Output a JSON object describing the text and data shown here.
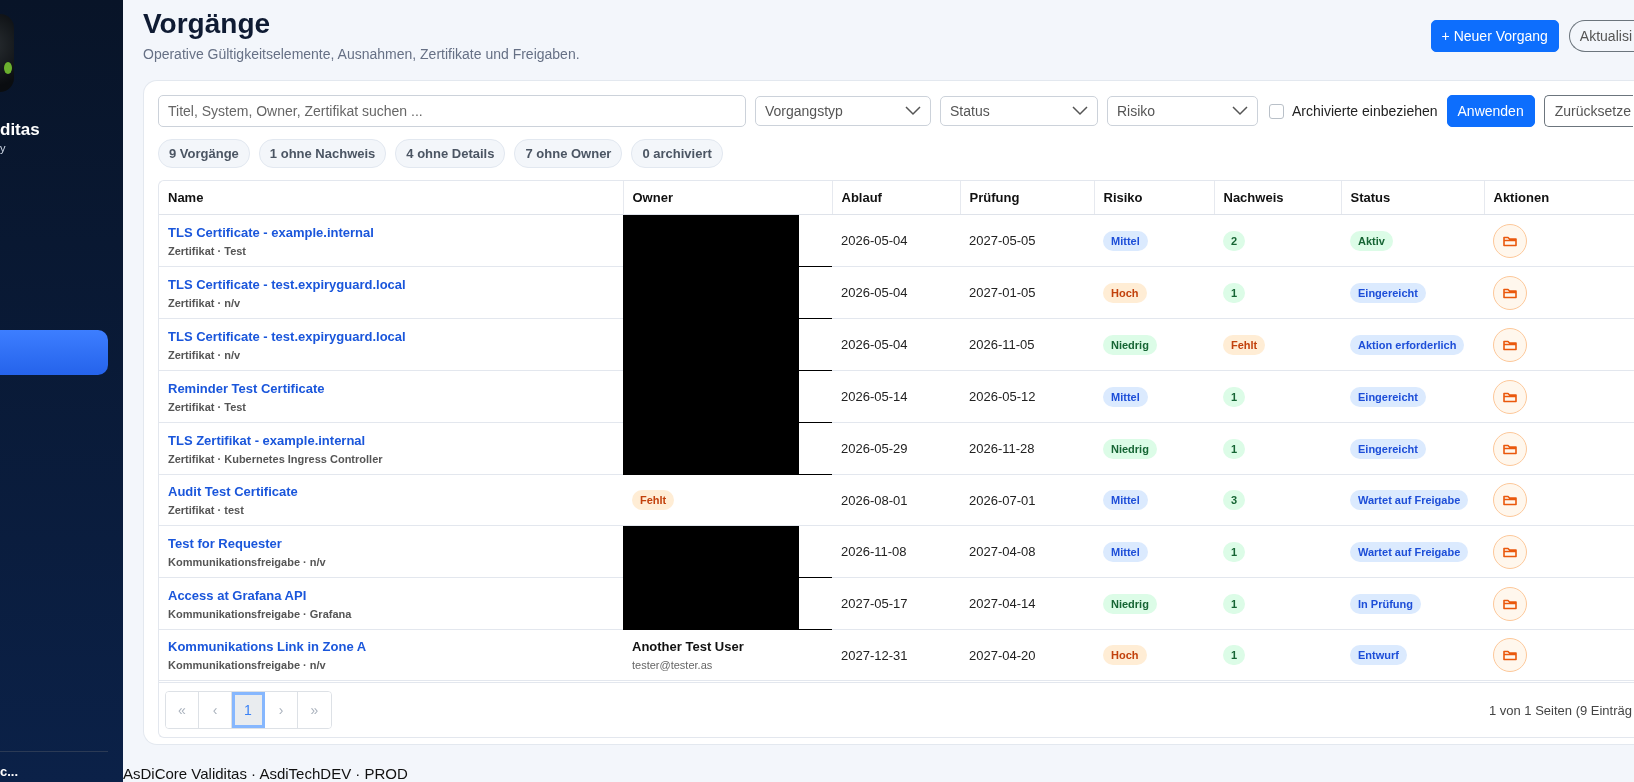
{
  "sidebar": {
    "brand": "ditas",
    "brand_sub": "y",
    "nav_items": [
      {
        "selected": true
      }
    ],
    "footer_user": "c..."
  },
  "header": {
    "title": "Vorgänge",
    "subtitle": "Operative Gültigkeitselemente, Ausnahmen, Zertifikate und Freigaben.",
    "buttons": [
      {
        "label": "+ Neuer Vorgang",
        "kind": "primary"
      },
      {
        "label": "Aktualisi",
        "kind": "outline"
      }
    ]
  },
  "filters": {
    "search": {
      "placeholder": "Titel, System, Owner, Zertifikat suchen ..."
    },
    "selects": [
      {
        "label": "Vorgangstyp"
      },
      {
        "label": "Status"
      },
      {
        "label": "Risiko"
      }
    ],
    "archived_checkbox": {
      "label": "Archivierte einbeziehen",
      "checked": false
    },
    "buttons": [
      {
        "label": "Anwenden",
        "kind": "primary"
      },
      {
        "label": "Zurücksetze",
        "kind": "outline"
      }
    ]
  },
  "chips": [
    "9 Vorgänge",
    "1 ohne Nachweis",
    "4 ohne Details",
    "7 ohne Owner",
    "0 archiviert"
  ],
  "table": {
    "columns": [
      "Name",
      "Owner",
      "Ablauf",
      "Prüfung",
      "Risiko",
      "Nachweis",
      "Status",
      "Aktionen"
    ],
    "rows": [
      {
        "name": "TLS Certificate - example.internal",
        "meta": "Zertifikat · Test",
        "owner": {
          "kind": "redacted"
        },
        "ablauf": "2026-05-04",
        "pruefung": "2027-05-05",
        "risiko": {
          "label": "Mittel",
          "kind": "blue"
        },
        "nachweis": {
          "label": "2",
          "kind": "green"
        },
        "status": {
          "label": "Aktiv",
          "kind": "green"
        }
      },
      {
        "name": "TLS Certificate - test.expiryguard.local",
        "meta": "Zertifikat · n/v",
        "owner": {
          "kind": "redacted"
        },
        "ablauf": "2026-05-04",
        "pruefung": "2027-01-05",
        "risiko": {
          "label": "Hoch",
          "kind": "orange"
        },
        "nachweis": {
          "label": "1",
          "kind": "green"
        },
        "status": {
          "label": "Eingereicht",
          "kind": "blue"
        }
      },
      {
        "name": "TLS Certificate - test.expiryguard.local",
        "meta": "Zertifikat · n/v",
        "owner": {
          "kind": "redacted"
        },
        "ablauf": "2026-05-04",
        "pruefung": "2026-11-05",
        "risiko": {
          "label": "Niedrig",
          "kind": "green"
        },
        "nachweis": {
          "label": "Fehlt",
          "kind": "orange"
        },
        "status": {
          "label": "Aktion erforderlich",
          "kind": "blue"
        }
      },
      {
        "name": "Reminder Test Certificate",
        "meta": "Zertifikat · Test",
        "owner": {
          "kind": "redacted"
        },
        "ablauf": "2026-05-14",
        "pruefung": "2026-05-12",
        "risiko": {
          "label": "Mittel",
          "kind": "blue"
        },
        "nachweis": {
          "label": "1",
          "kind": "green"
        },
        "status": {
          "label": "Eingereicht",
          "kind": "blue"
        }
      },
      {
        "name": "TLS Zertifikat - example.internal",
        "meta": "Zertifikat · Kubernetes Ingress Controller",
        "owner": {
          "kind": "redacted"
        },
        "ablauf": "2026-05-29",
        "pruefung": "2026-11-28",
        "risiko": {
          "label": "Niedrig",
          "kind": "green"
        },
        "nachweis": {
          "label": "1",
          "kind": "green"
        },
        "status": {
          "label": "Eingereicht",
          "kind": "blue"
        }
      },
      {
        "name": "Audit Test Certificate",
        "meta": "Zertifikat · test",
        "owner": {
          "kind": "missing",
          "label": "Fehlt"
        },
        "ablauf": "2026-08-01",
        "pruefung": "2026-07-01",
        "risiko": {
          "label": "Mittel",
          "kind": "blue"
        },
        "nachweis": {
          "label": "3",
          "kind": "green"
        },
        "status": {
          "label": "Wartet auf Freigabe",
          "kind": "blue"
        }
      },
      {
        "name": "Test for Requester",
        "meta": "Kommunikationsfreigabe · n/v",
        "owner": {
          "kind": "redacted"
        },
        "ablauf": "2026-11-08",
        "pruefung": "2027-04-08",
        "risiko": {
          "label": "Mittel",
          "kind": "blue"
        },
        "nachweis": {
          "label": "1",
          "kind": "green"
        },
        "status": {
          "label": "Wartet auf Freigabe",
          "kind": "blue"
        }
      },
      {
        "name": "Access at Grafana API",
        "meta": "Kommunikationsfreigabe · Grafana",
        "owner": {
          "kind": "redacted"
        },
        "ablauf": "2027-05-17",
        "pruefung": "2027-04-14",
        "risiko": {
          "label": "Niedrig",
          "kind": "green"
        },
        "nachweis": {
          "label": "1",
          "kind": "green"
        },
        "status": {
          "label": "In Prüfung",
          "kind": "blue"
        }
      },
      {
        "name": "Kommunikations Link in Zone A",
        "meta": "Kommunikationsfreigabe · n/v",
        "owner": {
          "kind": "user",
          "name": "Another Test User",
          "email": "tester@tester.as"
        },
        "ablauf": "2027-12-31",
        "pruefung": "2027-04-20",
        "risiko": {
          "label": "Hoch",
          "kind": "orange"
        },
        "nachweis": {
          "label": "1",
          "kind": "green"
        },
        "status": {
          "label": "Entwurf",
          "kind": "blue"
        }
      }
    ]
  },
  "pagination": {
    "pages": [
      {
        "label": "«",
        "selected": false,
        "disabled": true
      },
      {
        "label": "‹",
        "selected": false,
        "disabled": true
      },
      {
        "label": "1",
        "selected": true,
        "disabled": false
      },
      {
        "label": "›",
        "selected": false,
        "disabled": true
      },
      {
        "label": "»",
        "selected": false,
        "disabled": true
      }
    ],
    "info": "1 von 1 Seiten (9 Einträg"
  },
  "footer": "AsDiCore Validitas · AsdiTechDEV · PROD"
}
